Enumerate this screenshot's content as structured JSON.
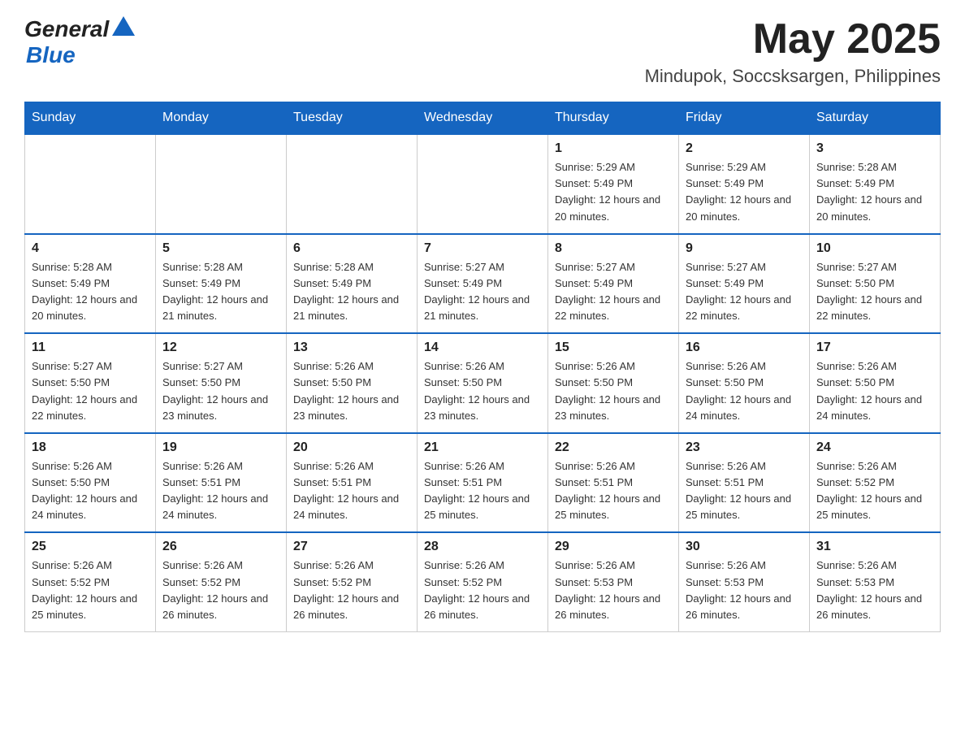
{
  "header": {
    "logo_general": "General",
    "logo_blue": "Blue",
    "month_year": "May 2025",
    "location": "Mindupok, Soccsksargen, Philippines"
  },
  "days_of_week": [
    "Sunday",
    "Monday",
    "Tuesday",
    "Wednesday",
    "Thursday",
    "Friday",
    "Saturday"
  ],
  "weeks": [
    [
      {
        "day": "",
        "sunrise": "",
        "sunset": "",
        "daylight": ""
      },
      {
        "day": "",
        "sunrise": "",
        "sunset": "",
        "daylight": ""
      },
      {
        "day": "",
        "sunrise": "",
        "sunset": "",
        "daylight": ""
      },
      {
        "day": "",
        "sunrise": "",
        "sunset": "",
        "daylight": ""
      },
      {
        "day": "1",
        "sunrise": "Sunrise: 5:29 AM",
        "sunset": "Sunset: 5:49 PM",
        "daylight": "Daylight: 12 hours and 20 minutes."
      },
      {
        "day": "2",
        "sunrise": "Sunrise: 5:29 AM",
        "sunset": "Sunset: 5:49 PM",
        "daylight": "Daylight: 12 hours and 20 minutes."
      },
      {
        "day": "3",
        "sunrise": "Sunrise: 5:28 AM",
        "sunset": "Sunset: 5:49 PM",
        "daylight": "Daylight: 12 hours and 20 minutes."
      }
    ],
    [
      {
        "day": "4",
        "sunrise": "Sunrise: 5:28 AM",
        "sunset": "Sunset: 5:49 PM",
        "daylight": "Daylight: 12 hours and 20 minutes."
      },
      {
        "day": "5",
        "sunrise": "Sunrise: 5:28 AM",
        "sunset": "Sunset: 5:49 PM",
        "daylight": "Daylight: 12 hours and 21 minutes."
      },
      {
        "day": "6",
        "sunrise": "Sunrise: 5:28 AM",
        "sunset": "Sunset: 5:49 PM",
        "daylight": "Daylight: 12 hours and 21 minutes."
      },
      {
        "day": "7",
        "sunrise": "Sunrise: 5:27 AM",
        "sunset": "Sunset: 5:49 PM",
        "daylight": "Daylight: 12 hours and 21 minutes."
      },
      {
        "day": "8",
        "sunrise": "Sunrise: 5:27 AM",
        "sunset": "Sunset: 5:49 PM",
        "daylight": "Daylight: 12 hours and 22 minutes."
      },
      {
        "day": "9",
        "sunrise": "Sunrise: 5:27 AM",
        "sunset": "Sunset: 5:49 PM",
        "daylight": "Daylight: 12 hours and 22 minutes."
      },
      {
        "day": "10",
        "sunrise": "Sunrise: 5:27 AM",
        "sunset": "Sunset: 5:50 PM",
        "daylight": "Daylight: 12 hours and 22 minutes."
      }
    ],
    [
      {
        "day": "11",
        "sunrise": "Sunrise: 5:27 AM",
        "sunset": "Sunset: 5:50 PM",
        "daylight": "Daylight: 12 hours and 22 minutes."
      },
      {
        "day": "12",
        "sunrise": "Sunrise: 5:27 AM",
        "sunset": "Sunset: 5:50 PM",
        "daylight": "Daylight: 12 hours and 23 minutes."
      },
      {
        "day": "13",
        "sunrise": "Sunrise: 5:26 AM",
        "sunset": "Sunset: 5:50 PM",
        "daylight": "Daylight: 12 hours and 23 minutes."
      },
      {
        "day": "14",
        "sunrise": "Sunrise: 5:26 AM",
        "sunset": "Sunset: 5:50 PM",
        "daylight": "Daylight: 12 hours and 23 minutes."
      },
      {
        "day": "15",
        "sunrise": "Sunrise: 5:26 AM",
        "sunset": "Sunset: 5:50 PM",
        "daylight": "Daylight: 12 hours and 23 minutes."
      },
      {
        "day": "16",
        "sunrise": "Sunrise: 5:26 AM",
        "sunset": "Sunset: 5:50 PM",
        "daylight": "Daylight: 12 hours and 24 minutes."
      },
      {
        "day": "17",
        "sunrise": "Sunrise: 5:26 AM",
        "sunset": "Sunset: 5:50 PM",
        "daylight": "Daylight: 12 hours and 24 minutes."
      }
    ],
    [
      {
        "day": "18",
        "sunrise": "Sunrise: 5:26 AM",
        "sunset": "Sunset: 5:50 PM",
        "daylight": "Daylight: 12 hours and 24 minutes."
      },
      {
        "day": "19",
        "sunrise": "Sunrise: 5:26 AM",
        "sunset": "Sunset: 5:51 PM",
        "daylight": "Daylight: 12 hours and 24 minutes."
      },
      {
        "day": "20",
        "sunrise": "Sunrise: 5:26 AM",
        "sunset": "Sunset: 5:51 PM",
        "daylight": "Daylight: 12 hours and 24 minutes."
      },
      {
        "day": "21",
        "sunrise": "Sunrise: 5:26 AM",
        "sunset": "Sunset: 5:51 PM",
        "daylight": "Daylight: 12 hours and 25 minutes."
      },
      {
        "day": "22",
        "sunrise": "Sunrise: 5:26 AM",
        "sunset": "Sunset: 5:51 PM",
        "daylight": "Daylight: 12 hours and 25 minutes."
      },
      {
        "day": "23",
        "sunrise": "Sunrise: 5:26 AM",
        "sunset": "Sunset: 5:51 PM",
        "daylight": "Daylight: 12 hours and 25 minutes."
      },
      {
        "day": "24",
        "sunrise": "Sunrise: 5:26 AM",
        "sunset": "Sunset: 5:52 PM",
        "daylight": "Daylight: 12 hours and 25 minutes."
      }
    ],
    [
      {
        "day": "25",
        "sunrise": "Sunrise: 5:26 AM",
        "sunset": "Sunset: 5:52 PM",
        "daylight": "Daylight: 12 hours and 25 minutes."
      },
      {
        "day": "26",
        "sunrise": "Sunrise: 5:26 AM",
        "sunset": "Sunset: 5:52 PM",
        "daylight": "Daylight: 12 hours and 26 minutes."
      },
      {
        "day": "27",
        "sunrise": "Sunrise: 5:26 AM",
        "sunset": "Sunset: 5:52 PM",
        "daylight": "Daylight: 12 hours and 26 minutes."
      },
      {
        "day": "28",
        "sunrise": "Sunrise: 5:26 AM",
        "sunset": "Sunset: 5:52 PM",
        "daylight": "Daylight: 12 hours and 26 minutes."
      },
      {
        "day": "29",
        "sunrise": "Sunrise: 5:26 AM",
        "sunset": "Sunset: 5:53 PM",
        "daylight": "Daylight: 12 hours and 26 minutes."
      },
      {
        "day": "30",
        "sunrise": "Sunrise: 5:26 AM",
        "sunset": "Sunset: 5:53 PM",
        "daylight": "Daylight: 12 hours and 26 minutes."
      },
      {
        "day": "31",
        "sunrise": "Sunrise: 5:26 AM",
        "sunset": "Sunset: 5:53 PM",
        "daylight": "Daylight: 12 hours and 26 minutes."
      }
    ]
  ]
}
